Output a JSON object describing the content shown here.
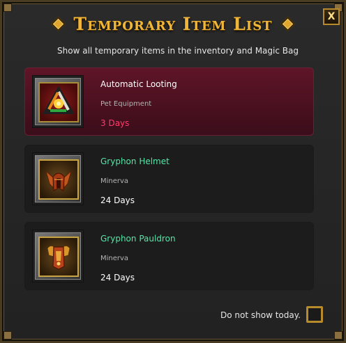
{
  "window": {
    "title": "Temporary Item List",
    "close_label": "X",
    "subtitle": "Show all temporary items in the inventory and Magic Bag"
  },
  "items": [
    {
      "name": "Automatic Looting",
      "category": "Pet Equipment",
      "duration": "3 Days",
      "icon": "automatic-looting-icon",
      "selected": true
    },
    {
      "name": "Gryphon Helmet",
      "category": "Minerva",
      "duration": "24 Days",
      "icon": "gryphon-helmet-icon",
      "selected": false
    },
    {
      "name": "Gryphon Pauldron",
      "category": "Minerva",
      "duration": "24 Days",
      "icon": "gryphon-pauldron-icon",
      "selected": false
    }
  ],
  "footer": {
    "dont_show_label": "Do not show today."
  },
  "colors": {
    "title": "#f0b63a",
    "item_name_green": "#55e6a6",
    "duration_red": "#ff3b6b",
    "selected_row": "#5e1527",
    "gold_border": "#b78b2c"
  }
}
